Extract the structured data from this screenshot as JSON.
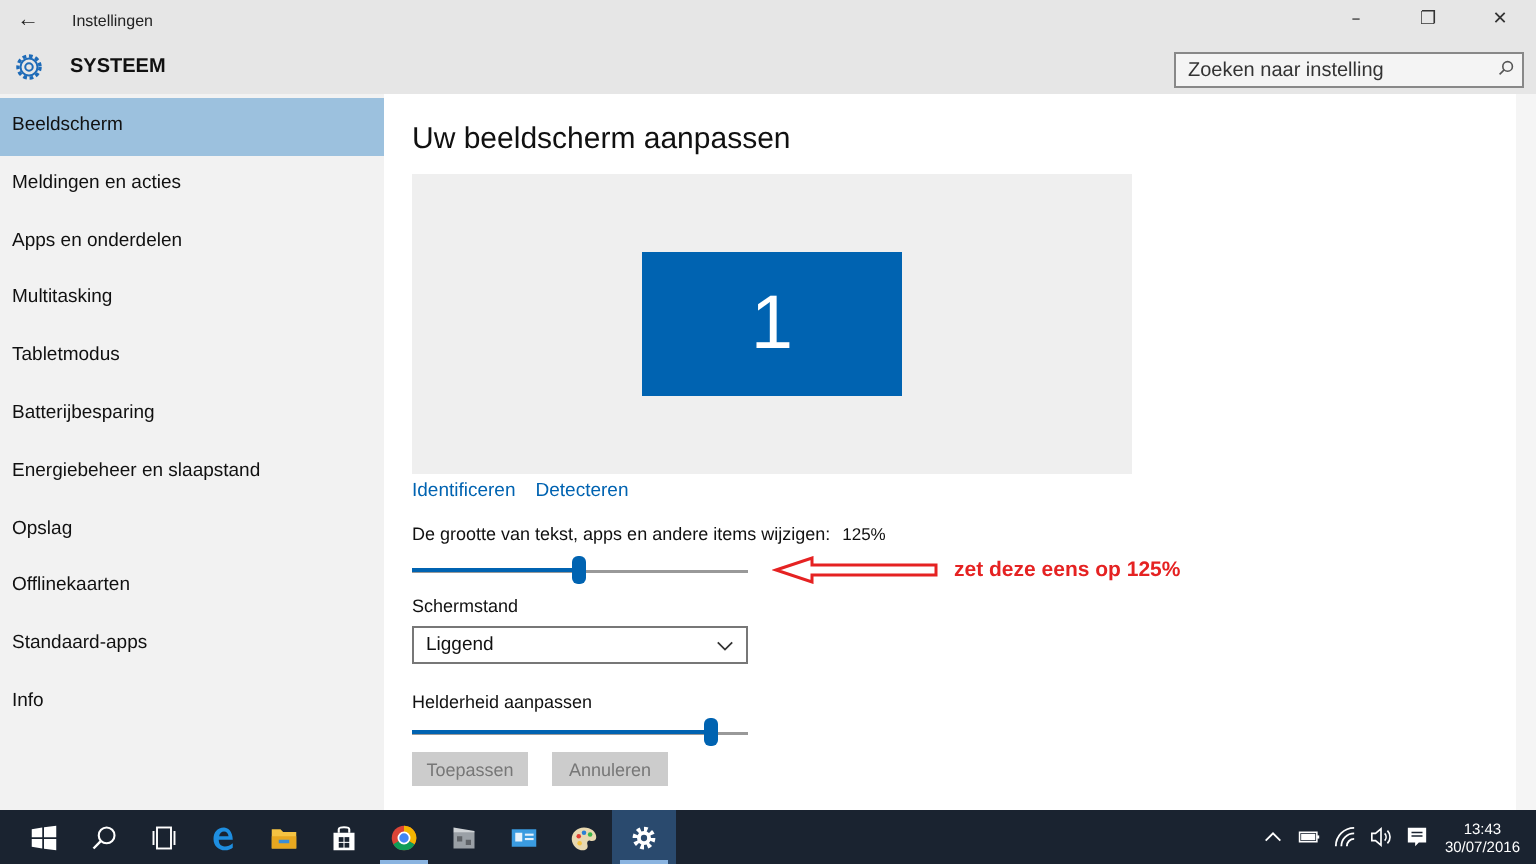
{
  "window": {
    "title": "Instellingen",
    "back": "←",
    "controls": [
      "–",
      "❐",
      "✕"
    ]
  },
  "header": {
    "title": "SYSTEEM",
    "search": {
      "placeholder": "Zoeken naar instelling"
    }
  },
  "sidebar": {
    "items": [
      {
        "label": "Beeldscherm",
        "selected": true
      },
      {
        "label": "Meldingen en acties",
        "selected": false
      },
      {
        "label": "Apps en onderdelen",
        "selected": false
      },
      {
        "label": "Multitasking",
        "selected": false
      },
      {
        "label": "Tabletmodus",
        "selected": false
      },
      {
        "label": "Batterijbesparing",
        "selected": false
      },
      {
        "label": "Energiebeheer en slaapstand",
        "selected": false
      },
      {
        "label": "Opslag",
        "selected": false
      },
      {
        "label": "Offlinekaarten",
        "selected": false
      },
      {
        "label": "Standaard-apps",
        "selected": false
      },
      {
        "label": "Info",
        "selected": false
      }
    ]
  },
  "main": {
    "title": "Uw beeldscherm aanpassen",
    "monitor": {
      "number": "1"
    },
    "links": [
      "Identificeren",
      "Detecteren"
    ],
    "scale": {
      "label": "De grootte van tekst, apps en andere items wijzigen:",
      "reading": "125%",
      "level": 0.5
    },
    "annotation": {
      "text": "zet deze eens op 125%"
    },
    "orientation": {
      "label": "Schermstand",
      "value": "Liggend"
    },
    "brightness": {
      "label": "Helderheid aanpassen",
      "level": 0.89
    },
    "buttons": [
      "Toepassen",
      "Annuleren"
    ]
  },
  "taskbar": {
    "items": [
      {
        "kind": "start",
        "selected": false,
        "running": false
      },
      {
        "kind": "search",
        "selected": false,
        "running": false
      },
      {
        "kind": "taskview",
        "selected": false,
        "running": false
      },
      {
        "kind": "browser",
        "selected": false,
        "running": false
      },
      {
        "kind": "folder",
        "selected": false,
        "running": false
      },
      {
        "kind": "bag",
        "selected": false,
        "running": false
      },
      {
        "kind": "round",
        "selected": false,
        "running": true
      },
      {
        "kind": "film",
        "selected": false,
        "running": false
      },
      {
        "kind": "card",
        "selected": false,
        "running": false
      },
      {
        "kind": "palette",
        "selected": false,
        "running": false
      },
      {
        "kind": "gear",
        "selected": true,
        "running": true
      }
    ],
    "time": "13:43",
    "date": "30/07/2016"
  }
}
